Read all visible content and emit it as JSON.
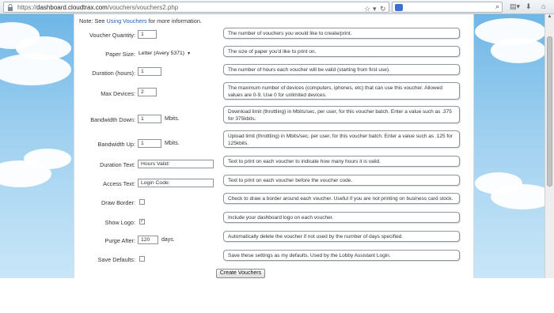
{
  "browser": {
    "url_prefix": "https://",
    "url_domain": "dashboard.cloudtrax.com",
    "url_path": "/vouchers/vouchers2.php"
  },
  "note": {
    "prefix": "Note: See ",
    "link": "Using Vouchers",
    "suffix": " for more information."
  },
  "form": {
    "voucher_quantity": {
      "label": "Voucher Quantity:",
      "value": "1",
      "help": "The number of vouchers you would like to create/print."
    },
    "paper_size": {
      "label": "Paper Size:",
      "value": "Letter (Avery 5371)",
      "help": "The size of paper you'd like to print on."
    },
    "duration": {
      "label": "Duration (hours):",
      "value": "1",
      "help": "The number of hours each voucher will be valid (starting from first use)."
    },
    "max_devices": {
      "label": "Max Devices:",
      "value": "2",
      "help": "The maximum number of devices (computers, iphones, etc) that can use this voucher. Allowed values are 0-9. Use 0 for unlimited devices."
    },
    "bandwidth_down": {
      "label": "Bandwidth Down:",
      "value": "1",
      "unit": "Mbits.",
      "help": "Download limit (throttling) in Mbits/sec, per user, for this voucher batch. Enter a value such as .375 for 375kbits."
    },
    "bandwidth_up": {
      "label": "Bandwidth Up:",
      "value": "1",
      "unit": "Mbits.",
      "help": "Upload limit (throttling) in Mbits/sec, per user, for this voucher batch. Enter a value such as .125 for 125kbits."
    },
    "duration_text": {
      "label": "Duration Text:",
      "value": "Hours Valid:",
      "help": "Text to print on each voucher to indicate how many hours it is valid."
    },
    "access_text": {
      "label": "Access Text:",
      "value": "Login Code:",
      "help": "Text to print on each voucher before the voucher code."
    },
    "draw_border": {
      "label": "Draw Border:",
      "checked": false,
      "help": "Check to draw a border around each voucher. Useful if you are not printing on business card stock."
    },
    "show_logo": {
      "label": "Show Logo:",
      "checked": true,
      "help": "Include your dashboard logo on each voucher."
    },
    "purge_after": {
      "label": "Purge After:",
      "value": "120",
      "unit": "days.",
      "help": "Automatically delete the voucher if not used by the number of days specified."
    },
    "save_defaults": {
      "label": "Save Defaults:",
      "checked": false,
      "help": "Save these settings as my defaults. Used by the Lobby Assistant Login."
    }
  },
  "submit_label": "Create Vouchers",
  "icons": {
    "lock": "lock-icon",
    "bookmark": "star-icon",
    "reload": "reload-icon",
    "search": "search-icon",
    "bookmarks_menu": "bookmarks-icon",
    "download": "download-icon",
    "home": "home-icon"
  }
}
